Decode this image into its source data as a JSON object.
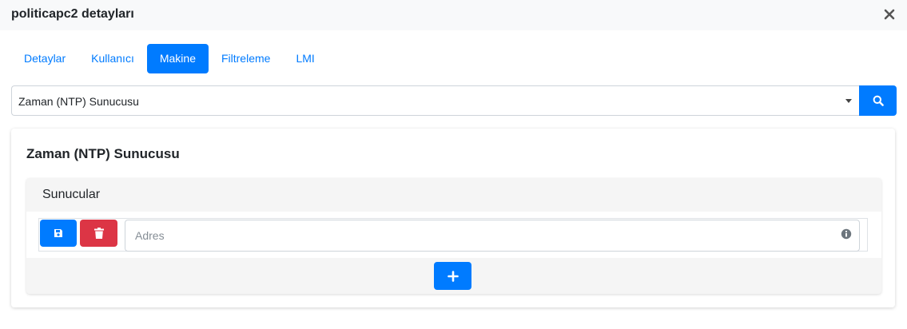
{
  "modal": {
    "title": "politicapc2 detayları",
    "close_icon": "close-icon"
  },
  "tabs": [
    {
      "label": "Detaylar",
      "active": false
    },
    {
      "label": "Kullanıcı",
      "active": false
    },
    {
      "label": "Makine",
      "active": true
    },
    {
      "label": "Filtreleme",
      "active": false
    },
    {
      "label": "LMI",
      "active": false
    }
  ],
  "selector": {
    "selected": "Zaman (NTP) Sunucusu",
    "search_icon": "search-icon"
  },
  "section": {
    "title": "Zaman (NTP) Sunucusu",
    "panel": {
      "title": "Sunucular",
      "rows": [
        {
          "address_value": "",
          "address_placeholder": "Adres"
        }
      ],
      "row_icons": [
        "save-icon",
        "trash-icon",
        "info-icon"
      ],
      "add_icon": "plus-icon"
    }
  },
  "colors": {
    "primary": "#007bff",
    "danger": "#dc3545",
    "header_bg": "#f8f9fa",
    "panel_bg": "#f5f5f5"
  }
}
